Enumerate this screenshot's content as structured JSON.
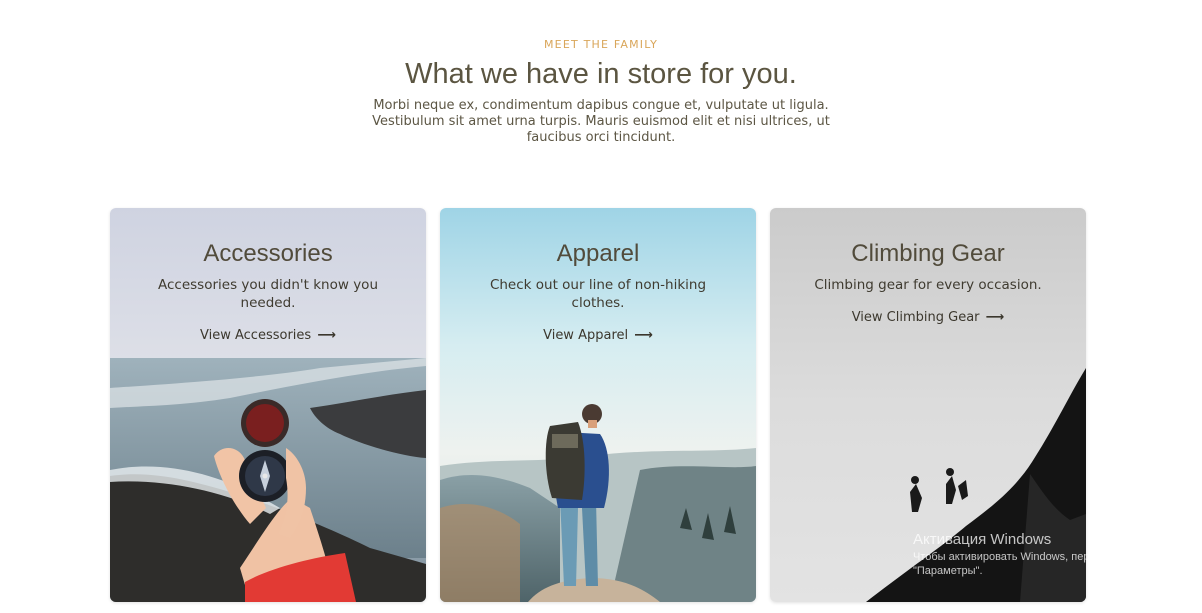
{
  "section": {
    "eyebrow": "MEET THE FAMILY",
    "title": "What we have in store for you.",
    "description": "Morbi neque ex, condimentum dapibus congue et, vulputate ut ligula. Vestibulum sit amet urna turpis. Mauris euismod elit et nisi ultrices, ut faucibus orci tincidunt."
  },
  "cards": [
    {
      "title": "Accessories",
      "description": "Accessories you didn't know you needed.",
      "link": "View Accessories",
      "arrow": "⟶",
      "image": "compass-on-cliff-image"
    },
    {
      "title": "Apparel",
      "description": "Check out our line of non-hiking clothes.",
      "link": "View Apparel",
      "arrow": "⟶",
      "image": "hiker-on-mountain-image"
    },
    {
      "title": "Climbing Gear",
      "description": "Climbing gear for every occasion.",
      "link": "View Climbing Gear",
      "arrow": "⟶",
      "image": "climbers-on-ridge-image"
    }
  ],
  "colors": {
    "eyebrow": "#d9a65a",
    "heading": "#5b5541",
    "text": "#5c5644"
  },
  "watermark": {
    "title": "Активация Windows",
    "line1": "Чтобы активировать Windows, перейдите в раздел",
    "line2": "\"Параметры\"."
  }
}
